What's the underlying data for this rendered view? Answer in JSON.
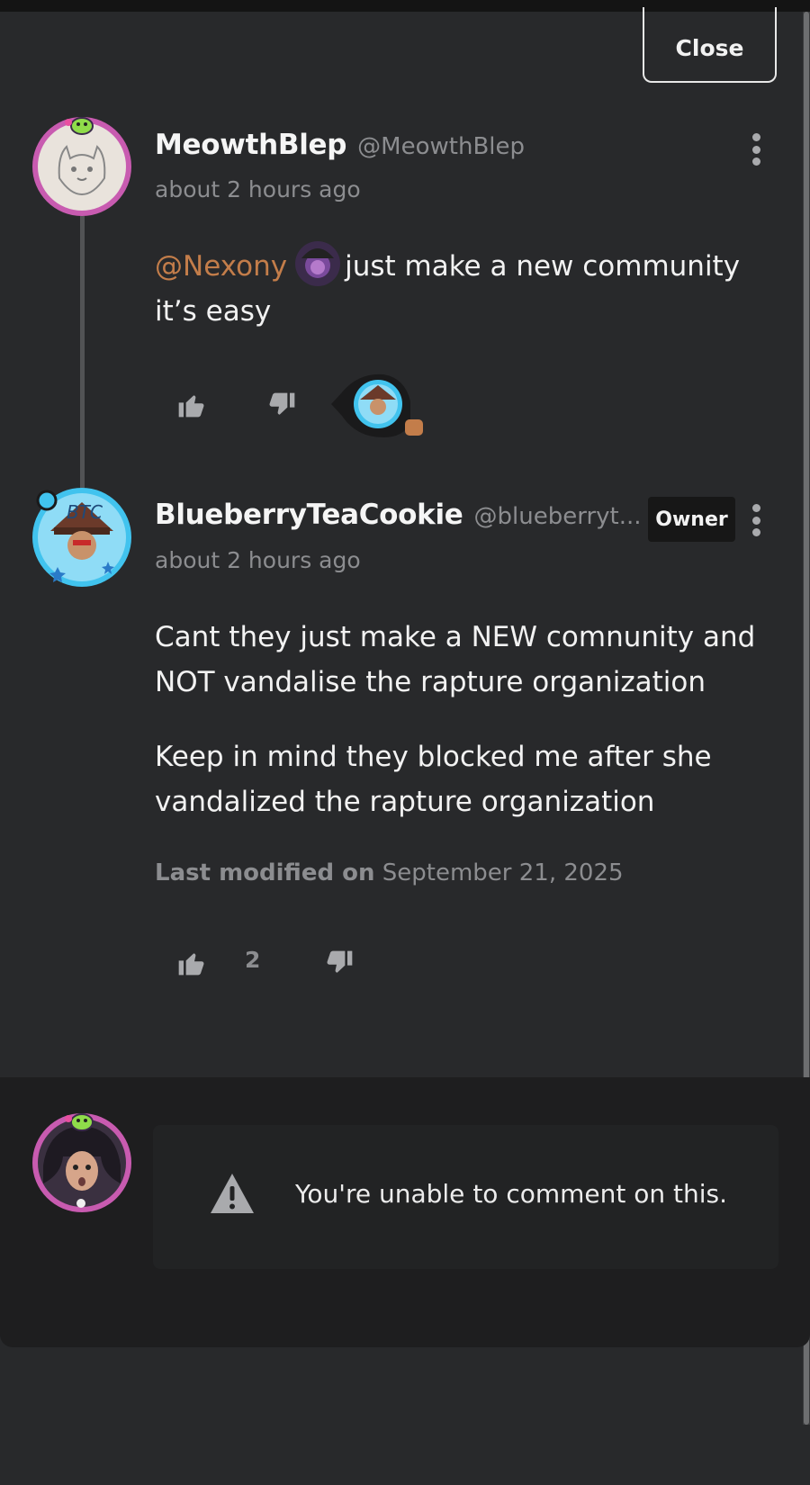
{
  "close_label": "Close",
  "comments": [
    {
      "username": "MeowthBlep",
      "handle": "@MeowthBlep",
      "timestamp": "about 2 hours ago",
      "mention": "@Nexony",
      "text_after_mention": "just make a new community it’s easy",
      "avatar_icon": "meowth-sketch-avatar"
    },
    {
      "username": "BlueberryTeaCookie",
      "handle": "@blueberryt...",
      "badge": "Owner",
      "timestamp": "about 2 hours ago",
      "paragraphs": [
        "Cant they just make a NEW comnunity and NOT vandalise the rapture organization",
        "Keep in mind they blocked me after she vandalized the rapture organization"
      ],
      "last_modified_label": "Last modified on",
      "last_modified_date": "September 21, 2025",
      "like_count": "2",
      "avatar_icon": "btc-avatar"
    }
  ],
  "notice_text": "You're unable to comment on this.",
  "colors": {
    "background": "#28292b",
    "footer": "#1e1e1f",
    "mention": "#c37d4a",
    "muted": "#8c8d90",
    "avatar_ring_pink": "#c85bb0",
    "avatar_ring_blue": "#41c3ee"
  }
}
